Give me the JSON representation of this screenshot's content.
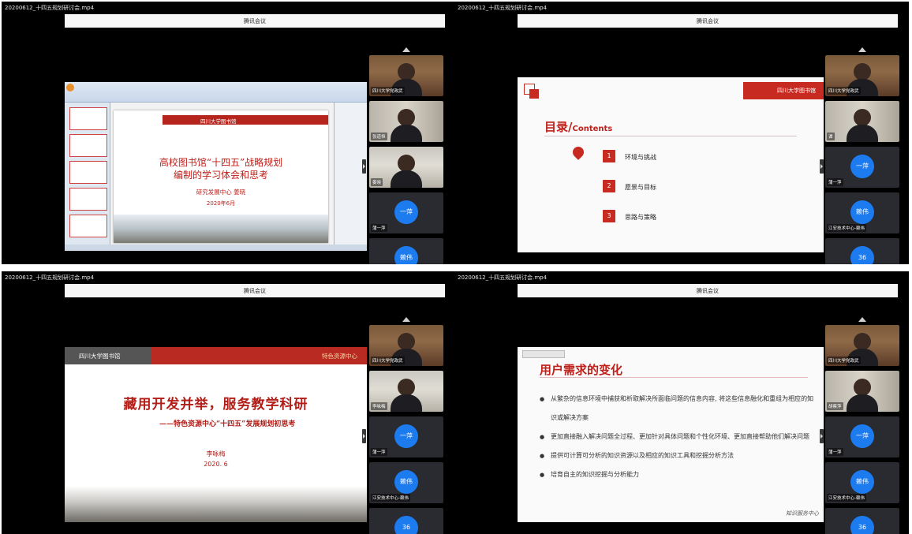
{
  "file_name": "20200612_十四五规划研讨会.mp4",
  "meeting_title": "腾讯会议",
  "participants": {
    "sichuan": "四川大学党政武",
    "zhang": "张道恒",
    "jiang": "姜晓",
    "yiping": "一萍",
    "yiping_label": "蒲一萍",
    "laiwei": "赖伟",
    "laiwei_label": "江安技术中心-赖伟",
    "liying": "李咏梅",
    "hucaiping": "胡蔡萍",
    "tan": "谭",
    "count": "36"
  },
  "slide1": {
    "logo": "四川大学图书馆",
    "title_line1": "高校图书馆“十四五”战略规划",
    "title_line2": "编制的学习体会和思考",
    "author": "研究发展中心    姜晓",
    "date": "2020年6月"
  },
  "slide2": {
    "logo": "四川大学图书馆",
    "heading": "目录/",
    "heading_en": "Contents",
    "items": [
      {
        "num": "1",
        "label": "环境与挑战"
      },
      {
        "num": "2",
        "label": "愿景与目标"
      },
      {
        "num": "3",
        "label": "思路与策略"
      }
    ]
  },
  "slide3": {
    "logo": "四川大学图书馆",
    "tag": "特色资源中心",
    "title": "藏用开发并举，服务教学科研",
    "subtitle": "——特色资源中心“十四五”发展规划初思考",
    "author": "李咏梅",
    "date": "2020. 6"
  },
  "slide4": {
    "heading": "用户需求的变化",
    "bullets": [
      "从繁杂的信息环境中捕获和析取解决所面临问题的信息内容, 将这些信息融化和重组为相应的知识或解决方案",
      "更加直接融入解决问题全过程、更加针对具体问题和个性化环境、更加直接帮助他们解决问题",
      "提供可计算可分析的知识资源以及相应的知识工具和挖掘分析方法",
      "培育自主的知识挖掘与分析能力"
    ],
    "signature": "知识服务中心"
  },
  "colors": {
    "accent_red": "#c0201a",
    "avatar_blue": "#1d7bf0"
  }
}
